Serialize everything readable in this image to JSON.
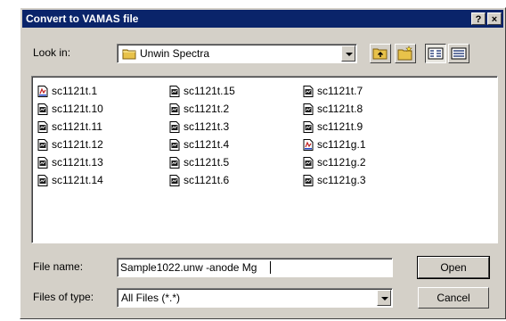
{
  "dialog": {
    "title": "Convert to VAMAS file",
    "help_label": "?",
    "close_label": "×"
  },
  "lookin": {
    "label": "Look in:",
    "value": "Unwin Spectra"
  },
  "files": [
    {
      "name": "sc1121t.1",
      "icon": "document-icon-vamas"
    },
    {
      "name": "sc1121t.10",
      "icon": "document-icon"
    },
    {
      "name": "sc1121t.11",
      "icon": "document-icon"
    },
    {
      "name": "sc1121t.12",
      "icon": "document-icon"
    },
    {
      "name": "sc1121t.13",
      "icon": "document-icon"
    },
    {
      "name": "sc1121t.14",
      "icon": "document-icon"
    },
    {
      "name": "sc1121t.15",
      "icon": "document-icon"
    },
    {
      "name": "sc1121t.2",
      "icon": "document-icon"
    },
    {
      "name": "sc1121t.3",
      "icon": "document-icon"
    },
    {
      "name": "sc1121t.4",
      "icon": "document-icon"
    },
    {
      "name": "sc1121t.5",
      "icon": "document-icon"
    },
    {
      "name": "sc1121t.6",
      "icon": "document-icon"
    },
    {
      "name": "sc1121t.7",
      "icon": "document-icon"
    },
    {
      "name": "sc1121t.8",
      "icon": "document-icon"
    },
    {
      "name": "sc1121t.9",
      "icon": "document-icon"
    },
    {
      "name": "sc1121g.1",
      "icon": "document-icon-vamas"
    },
    {
      "name": "sc1121g.2",
      "icon": "document-icon"
    },
    {
      "name": "sc1121g.3",
      "icon": "document-icon"
    }
  ],
  "filename": {
    "label": "File name:",
    "value": "Sample1022.unw -anode Mg"
  },
  "filetype": {
    "label": "Files of type:",
    "value": "All Files (*.*)"
  },
  "buttons": {
    "open": "Open",
    "cancel": "Cancel"
  },
  "colors": {
    "titlebar": "#0a246a",
    "face": "#d4d0c8"
  }
}
